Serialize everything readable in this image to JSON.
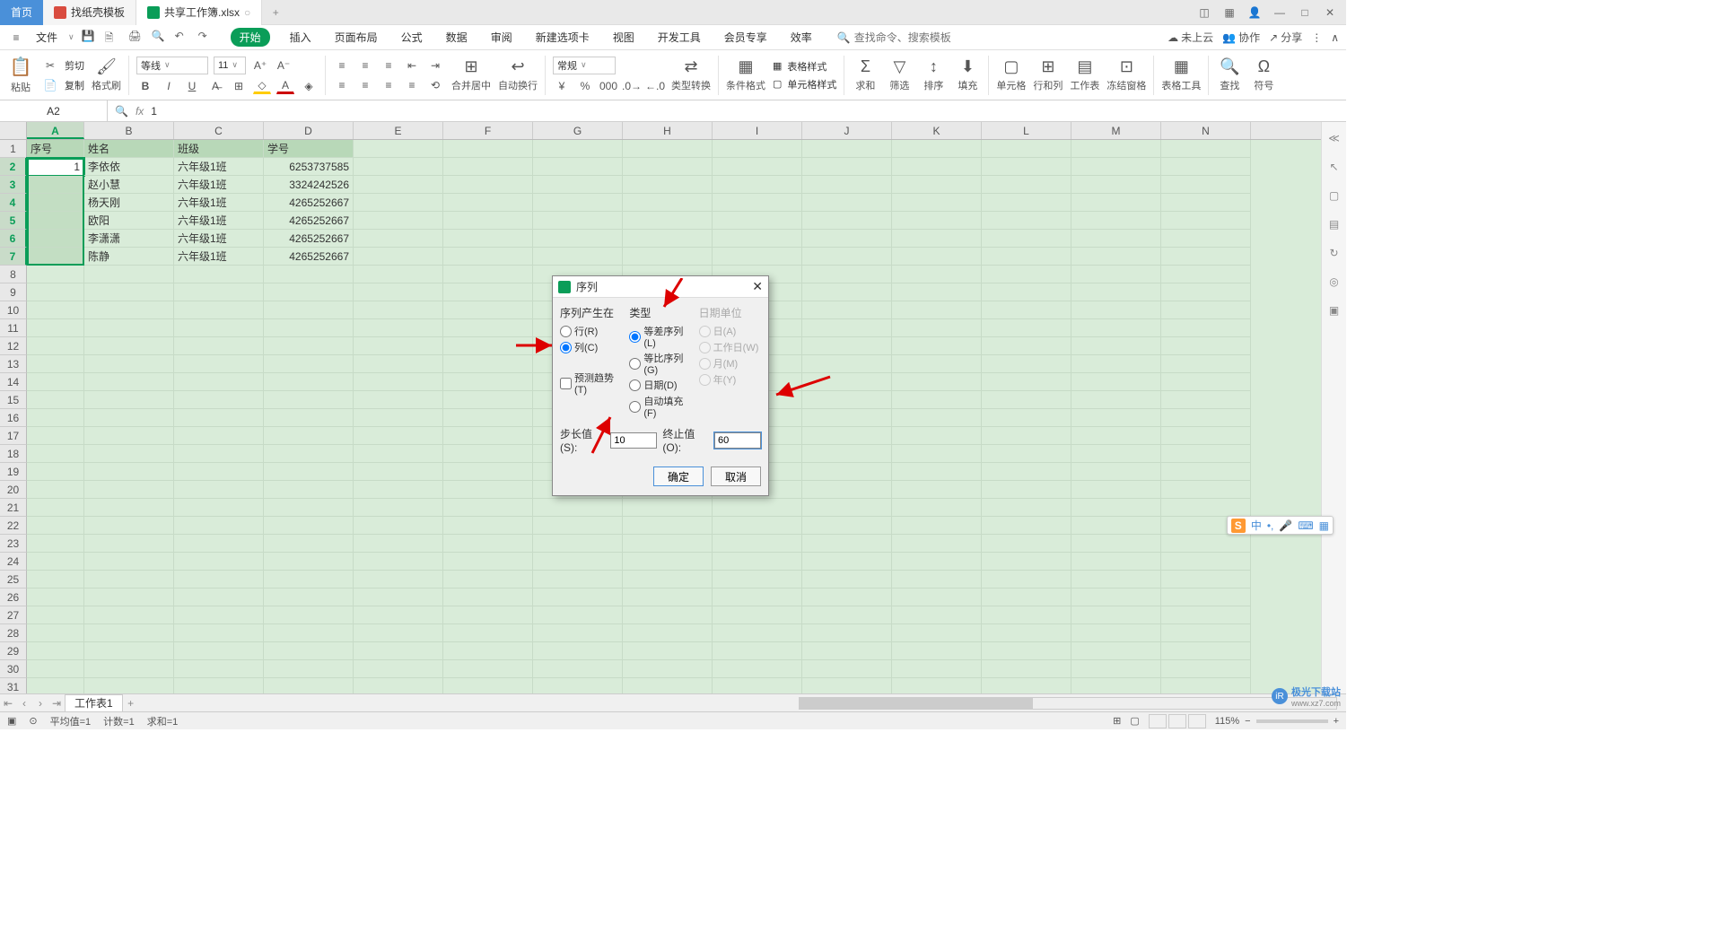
{
  "titlebar": {
    "home": "首页",
    "tab1": "找纸壳模板",
    "tab2": "共享工作簿.xlsx",
    "modified_marker": "○"
  },
  "menubar": {
    "file": "文件",
    "tabs": [
      "开始",
      "插入",
      "页面布局",
      "公式",
      "数据",
      "审阅",
      "新建选项卡",
      "视图",
      "开发工具",
      "会员专享",
      "效率"
    ],
    "search_placeholder": "查找命令、搜索模板",
    "cloud": "未上云",
    "coop": "协作",
    "share": "分享"
  },
  "ribbon": {
    "paste": "粘贴",
    "cut": "剪切",
    "copy": "复制",
    "format_painter": "格式刷",
    "font_name": "等线",
    "font_size": "11",
    "number_format": "常规",
    "merge": "合并居中",
    "wrap": "自动换行",
    "type_convert": "类型转换",
    "condfmt": "条件格式",
    "tablefmt": "表格样式",
    "cellfmt": "单元格样式",
    "sum": "求和",
    "filter": "筛选",
    "sort": "排序",
    "fill": "填充",
    "cellop": "单元格",
    "rowcol": "行和列",
    "worksheet": "工作表",
    "freeze": "冻结窗格",
    "tabletool": "表格工具",
    "find": "查找",
    "symbol": "符号"
  },
  "namebox": "A2",
  "formula_value": "1",
  "columns": [
    "A",
    "B",
    "C",
    "D",
    "E",
    "F",
    "G",
    "H",
    "I",
    "J",
    "K",
    "L",
    "M",
    "N"
  ],
  "headers": [
    "序号",
    "姓名",
    "班级",
    "学号"
  ],
  "data_rows": [
    {
      "a": "1",
      "b": "李依依",
      "c": "六年级1班",
      "d": "6253737585"
    },
    {
      "a": "",
      "b": "赵小慧",
      "c": "六年级1班",
      "d": "3324242526"
    },
    {
      "a": "",
      "b": "杨天刚",
      "c": "六年级1班",
      "d": "4265252667"
    },
    {
      "a": "",
      "b": "欧阳",
      "c": "六年级1班",
      "d": "4265252667"
    },
    {
      "a": "",
      "b": "李潇潇",
      "c": "六年级1班",
      "d": "4265252667"
    },
    {
      "a": "",
      "b": "陈静",
      "c": "六年级1班",
      "d": "4265252667"
    }
  ],
  "sheet_tab": "工作表1",
  "dialog": {
    "title": "序列",
    "group1": "序列产生在",
    "row_opt": "行(R)",
    "col_opt": "列(C)",
    "group2": "类型",
    "arith": "等差序列(L)",
    "geom": "等比序列(G)",
    "date": "日期(D)",
    "autofill": "自动填充(F)",
    "group3": "日期单位",
    "day": "日(A)",
    "weekday": "工作日(W)",
    "month": "月(M)",
    "year": "年(Y)",
    "trend": "预测趋势(T)",
    "step_label": "步长值(S):",
    "step_value": "10",
    "stop_label": "终止值(O):",
    "stop_value": "60",
    "ok": "确定",
    "cancel": "取消"
  },
  "status": {
    "avg": "平均值=1",
    "count": "计数=1",
    "sum": "求和=1",
    "zoom": "115%"
  },
  "ime": {
    "zh": "中",
    "symbol": "•,",
    "mic": "🎤"
  },
  "watermark": {
    "name": "极光下载站",
    "url": "www.xz7.com"
  }
}
